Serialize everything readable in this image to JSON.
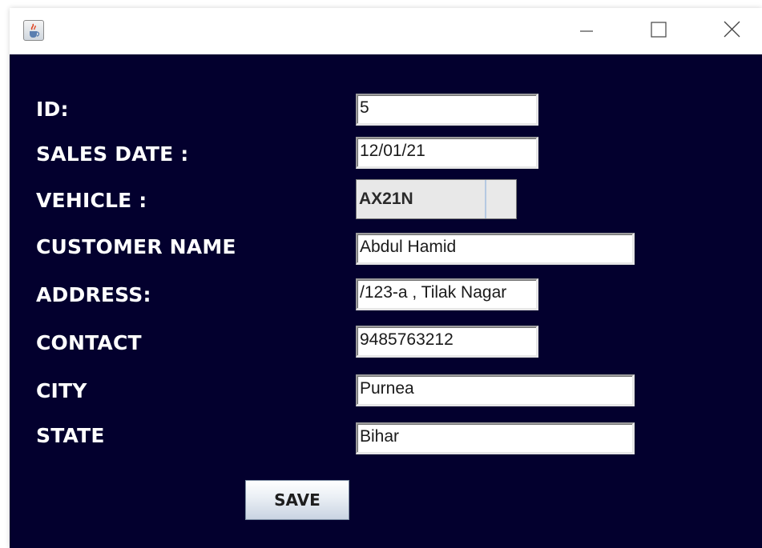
{
  "window": {
    "icon": "java-cup-icon",
    "controls": {
      "minimize": "minimize-icon",
      "maximize": "maximize-icon",
      "close": "close-icon"
    }
  },
  "form": {
    "background_color": "#03002e",
    "fields": {
      "id": {
        "label": "ID:",
        "value": "5"
      },
      "sales_date": {
        "label": "SALES DATE :",
        "value": "12/01/21"
      },
      "vehicle": {
        "label": "VEHICLE :",
        "value": "AX21N"
      },
      "customer_name": {
        "label": "CUSTOMER NAME",
        "value": "Abdul Hamid"
      },
      "address": {
        "label": "ADDRESS:",
        "value": "/123-a , Tilak Nagar"
      },
      "contact": {
        "label": "CONTACT",
        "value": "9485763212"
      },
      "city": {
        "label": "CITY",
        "value": "Purnea"
      },
      "state": {
        "label": "STATE",
        "value": "Bihar"
      }
    },
    "save_label": "SAVE"
  }
}
